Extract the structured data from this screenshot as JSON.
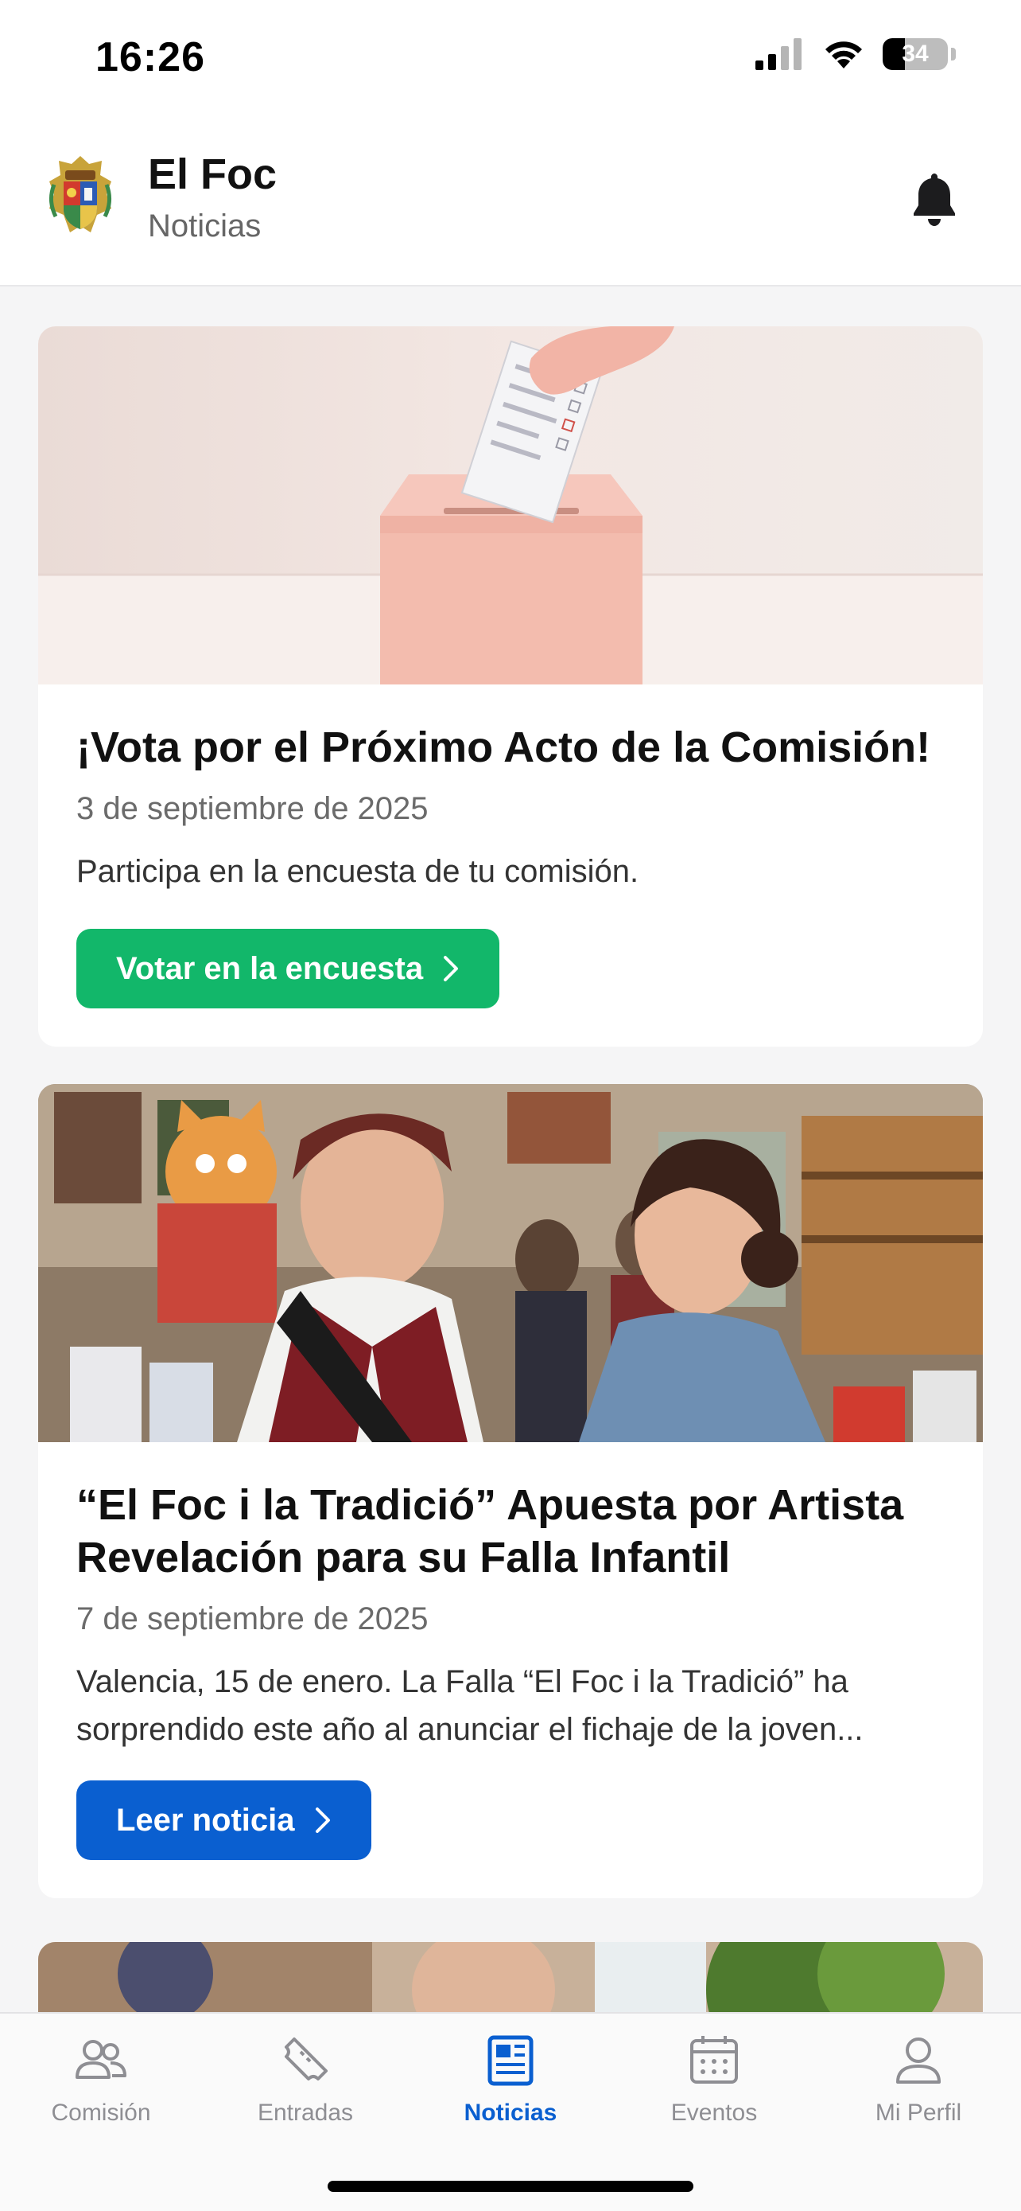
{
  "status_bar": {
    "time": "16:26",
    "battery": "34",
    "battery_level": 0.34
  },
  "header": {
    "title": "El Foc",
    "subtitle": "Noticias",
    "logo_icon": "coat-of-arms-icon",
    "notification_icon": "bell-icon"
  },
  "feed": {
    "cards": [
      {
        "image": "ballot-box-photo",
        "title": "¡Vota por el Próximo Acto de la Comisión!",
        "date": "3 de septiembre de 2025",
        "description": "Participa en la encuesta de tu comisión.",
        "button_label": "Votar en la encuesta",
        "button_color": "#12b76a"
      },
      {
        "image": "falla-artists-photo",
        "title": "“El Foc i la Tradició” Apuesta por Artista Revelación para su Falla Infantil",
        "date": "7 de septiembre de 2025",
        "description": "Valencia, 15 de enero. La Falla “El Foc i la Tradició” ha sorprendido este año al anunciar el fichaje de la joven...",
        "button_label": "Leer noticia",
        "button_color": "#0a5fd0"
      }
    ]
  },
  "tab_bar": {
    "active": "Noticias",
    "active_color": "#0a5fd0",
    "tabs": [
      {
        "label": "Comisión",
        "icon": "people-icon"
      },
      {
        "label": "Entradas",
        "icon": "ticket-icon"
      },
      {
        "label": "Noticias",
        "icon": "newspaper-icon"
      },
      {
        "label": "Eventos",
        "icon": "calendar-icon"
      },
      {
        "label": "Mi Perfil",
        "icon": "person-icon"
      }
    ]
  }
}
